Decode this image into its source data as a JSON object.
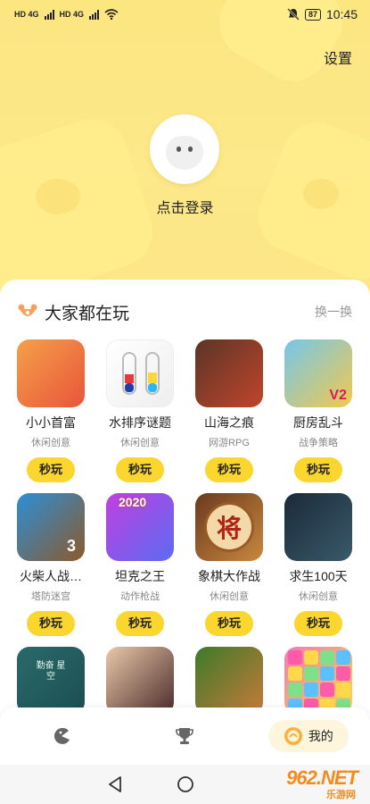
{
  "status_bar": {
    "sim1": "HD 4G",
    "sim2": "HD 4G",
    "battery": "87",
    "time": "10:45"
  },
  "header": {
    "settings_label": "设置",
    "login_label": "点击登录"
  },
  "section": {
    "title": "大家都在玩",
    "refresh_label": "换一换"
  },
  "games": [
    {
      "name": "小小首富",
      "category": "休闲创意",
      "action": "秒玩",
      "thumb_colors": [
        "#f4a04a",
        "#e9553a"
      ]
    },
    {
      "name": "水排序谜题",
      "category": "休闲创意",
      "action": "秒玩",
      "thumb_colors": [
        "#ffffff",
        "#eeeeee"
      ]
    },
    {
      "name": "山海之痕",
      "category": "网游RPG",
      "action": "秒玩",
      "thumb_colors": [
        "#5a3526",
        "#c2452c"
      ]
    },
    {
      "name": "厨房乱斗",
      "category": "战争策略",
      "action": "秒玩",
      "thumb_colors": [
        "#74c7ea",
        "#f2c94c"
      ]
    },
    {
      "name": "火柴人战…",
      "category": "塔防迷宫",
      "action": "秒玩",
      "thumb_colors": [
        "#2c8fd6",
        "#8b5a2b"
      ]
    },
    {
      "name": "坦克之王",
      "category": "动作枪战",
      "action": "秒玩",
      "thumb_colors": [
        "#c13fe0",
        "#5b6cf2"
      ]
    },
    {
      "name": "象棋大作战",
      "category": "休闲创意",
      "action": "秒玩",
      "thumb_colors": [
        "#6b3a1e",
        "#c8883f"
      ]
    },
    {
      "name": "求生100天",
      "category": "休闲创意",
      "action": "秒玩",
      "thumb_colors": [
        "#1a2a3a",
        "#3a5a6a"
      ]
    },
    {
      "name": "",
      "category": "",
      "action": "",
      "thumb_colors": [
        "#2a6a6a",
        "#1c4f52"
      ]
    },
    {
      "name": "",
      "category": "",
      "action": "",
      "thumb_colors": [
        "#e9c9a9",
        "#4a2a2a"
      ]
    },
    {
      "name": "",
      "category": "",
      "action": "",
      "thumb_colors": [
        "#3d7a2a",
        "#c87a3a"
      ]
    },
    {
      "name": "",
      "category": "",
      "action": "",
      "thumb_colors": [
        "#f07ab8",
        "#ffd84a"
      ]
    }
  ],
  "thumb_texts": {
    "water_sort_badge": "",
    "tank_year": "2020",
    "chess_char": "将",
    "kitchen_badge": "V2",
    "stickman_badge": "3",
    "game9_text": "勤奋 星空"
  },
  "tab_bar": {
    "mine_label": "我的"
  },
  "watermark": {
    "brand": "962.NET",
    "sub": "乐游网"
  },
  "colors": {
    "accent": "#fbd62e",
    "hero_bg": "#fde88a"
  }
}
